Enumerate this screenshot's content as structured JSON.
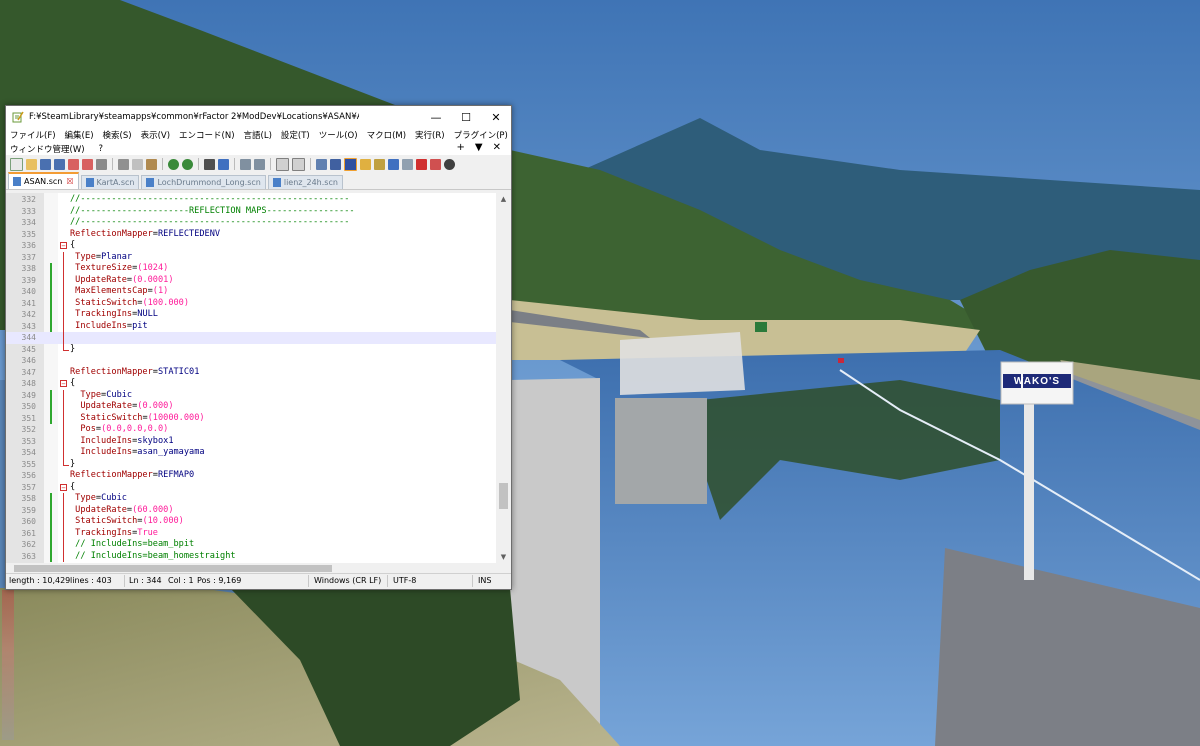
{
  "window": {
    "title": "F:¥SteamLibrary¥steamapps¥common¥rFactor 2¥ModDev¥Locations¥ASAN¥ASAN¥ASAN.scn - Note...",
    "minimize": "—",
    "maximize": "☐",
    "close": "✕"
  },
  "menu": {
    "row1": [
      "ファイル(F)",
      "編集(E)",
      "検索(S)",
      "表示(V)",
      "エンコード(N)",
      "言語(L)",
      "設定(T)",
      "ツール(O)",
      "マクロ(M)",
      "実行(R)",
      "プラグイン(P)"
    ],
    "row2": [
      "ウィンドウ管理(W)",
      "?"
    ],
    "extra_plus": "+",
    "extra_down": "▼",
    "extra_close": "✕"
  },
  "tabs": [
    {
      "label": "ASAN.scn",
      "active": true
    },
    {
      "label": "KartA.scn",
      "active": false
    },
    {
      "label": "LochDrummond_Long.scn",
      "active": false
    },
    {
      "label": "lienz_24h.scn",
      "active": false
    }
  ],
  "code_lines": [
    {
      "n": "332",
      "text": "//----------------------------------------------------",
      "cls": "comment"
    },
    {
      "n": "333",
      "text": "//---------------------REFLECTION MAPS-----------------",
      "cls": "comment"
    },
    {
      "n": "334",
      "text": "//----------------------------------------------------",
      "cls": "comment"
    },
    {
      "n": "335",
      "text": "ReflectionMapper=REFLECTEDENV",
      "cls": "kv"
    },
    {
      "n": "336",
      "text": "{",
      "cls": "plain"
    },
    {
      "n": "337",
      "text": " Type=Planar",
      "cls": "kv"
    },
    {
      "n": "338",
      "text": " TextureSize=(1024)",
      "cls": "kv"
    },
    {
      "n": "339",
      "text": " UpdateRate=(0.0001)",
      "cls": "kv"
    },
    {
      "n": "340",
      "text": " MaxElementsCap=(1)",
      "cls": "kv"
    },
    {
      "n": "341",
      "text": " StaticSwitch=(100.000)",
      "cls": "kv"
    },
    {
      "n": "342",
      "text": " TrackingIns=NULL",
      "cls": "kv"
    },
    {
      "n": "343",
      "text": " IncludeIns=pit",
      "cls": "kv"
    },
    {
      "n": "344",
      "text": "",
      "cls": "plain"
    },
    {
      "n": "345",
      "text": "}",
      "cls": "plain"
    },
    {
      "n": "346",
      "text": "",
      "cls": "plain"
    },
    {
      "n": "347",
      "text": "ReflectionMapper=STATIC01",
      "cls": "kv"
    },
    {
      "n": "348",
      "text": "{",
      "cls": "plain"
    },
    {
      "n": "349",
      "text": "  Type=Cubic",
      "cls": "kv"
    },
    {
      "n": "350",
      "text": "  UpdateRate=(0.000)",
      "cls": "kv"
    },
    {
      "n": "351",
      "text": "  StaticSwitch=(10000.000)",
      "cls": "kv"
    },
    {
      "n": "352",
      "text": "  Pos=(0.0,0.0,0.0)",
      "cls": "kv"
    },
    {
      "n": "353",
      "text": "  IncludeIns=skybox1",
      "cls": "kv"
    },
    {
      "n": "354",
      "text": "  IncludeIns=asan_yamayama",
      "cls": "kv"
    },
    {
      "n": "355",
      "text": "}",
      "cls": "plain"
    },
    {
      "n": "356",
      "text": "ReflectionMapper=REFMAP0",
      "cls": "kv"
    },
    {
      "n": "357",
      "text": "{",
      "cls": "plain"
    },
    {
      "n": "358",
      "text": " Type=Cubic",
      "cls": "kv"
    },
    {
      "n": "359",
      "text": " UpdateRate=(60.000)",
      "cls": "kv"
    },
    {
      "n": "360",
      "text": " StaticSwitch=(10.000)",
      "cls": "kv"
    },
    {
      "n": "361",
      "text": " TrackingIns=True",
      "cls": "kv"
    },
    {
      "n": "362",
      "text": " // IncludeIns=beam_bpit",
      "cls": "comment"
    },
    {
      "n": "363",
      "text": " // IncludeIns=beam_homestraight",
      "cls": "comment"
    }
  ],
  "status": {
    "length": "length : 10,429",
    "lines": "lines : 403",
    "ln": "Ln : 344",
    "col": "Col : 1",
    "pos": "Pos : 9,169",
    "eol": "Windows (CR LF)",
    "encoding": "UTF-8",
    "mode": "INS"
  },
  "scene": {
    "sign_text": "WAKO'S",
    "colors": {
      "sky": "#4f7fb9",
      "water": "#5b8fc7",
      "trees": "#3b5a2f",
      "grass": "#a7a27a",
      "road": "#7b7f86",
      "accent": "#c8283c"
    }
  }
}
